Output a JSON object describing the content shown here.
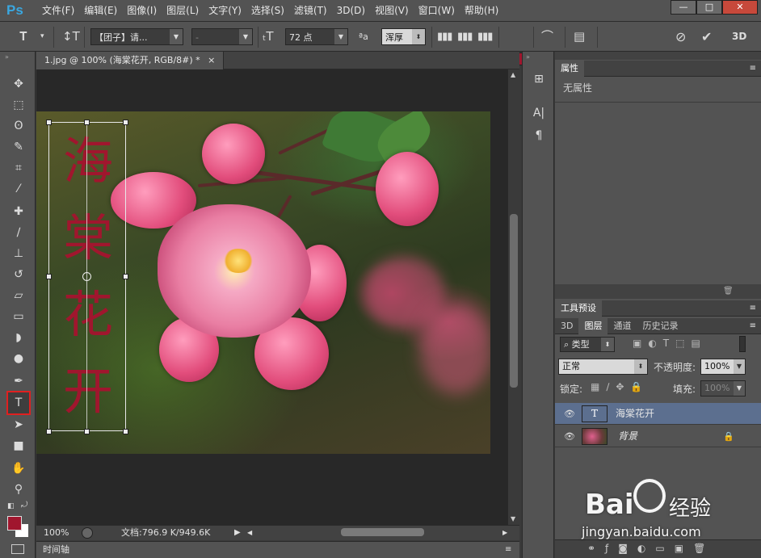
{
  "app": {
    "logo": "Ps"
  },
  "menu": [
    "文件(F)",
    "编辑(E)",
    "图像(I)",
    "图层(L)",
    "文字(Y)",
    "选择(S)",
    "滤镜(T)",
    "3D(D)",
    "视图(V)",
    "窗口(W)",
    "帮助(H)"
  ],
  "window_buttons": {
    "minimize": "—",
    "maximize": "□",
    "close": "✕"
  },
  "options": {
    "font_family": "【团子】请...",
    "font_style": "-",
    "font_size": "72 点",
    "antialias": "浑厚",
    "text_color": "#a0162e",
    "threed": "3D"
  },
  "document": {
    "tab_title": "1.jpg @ 100% (海棠花开, RGB/8#) *",
    "tab_close": "×",
    "vertical_text": [
      "海",
      "棠",
      "花",
      "开"
    ],
    "text_color": "#a0162e"
  },
  "status": {
    "zoom": "100%",
    "doc_size": "文档:796.9 K/949.6K"
  },
  "timeline": {
    "label": "时间轴"
  },
  "properties": {
    "tab": "属性",
    "empty_text": "无属性"
  },
  "tool_presets": {
    "tab": "工具预设"
  },
  "layers_panel": {
    "tabs": [
      "3D",
      "图层",
      "通道",
      "历史记录"
    ],
    "active_tab": "图层",
    "filter_kind": "类型",
    "blend_mode": "正常",
    "opacity_label": "不透明度:",
    "opacity_value": "100%",
    "lock_label": "锁定:",
    "fill_label": "填充:",
    "fill_value": "100%",
    "layers": [
      {
        "name": "海棠花开",
        "type": "text",
        "selected": true
      },
      {
        "name": "背景",
        "type": "image",
        "selected": false
      }
    ]
  },
  "watermark": {
    "brand": "Bai",
    "brand2": "经验",
    "url": "jingyan.baidu.com"
  }
}
